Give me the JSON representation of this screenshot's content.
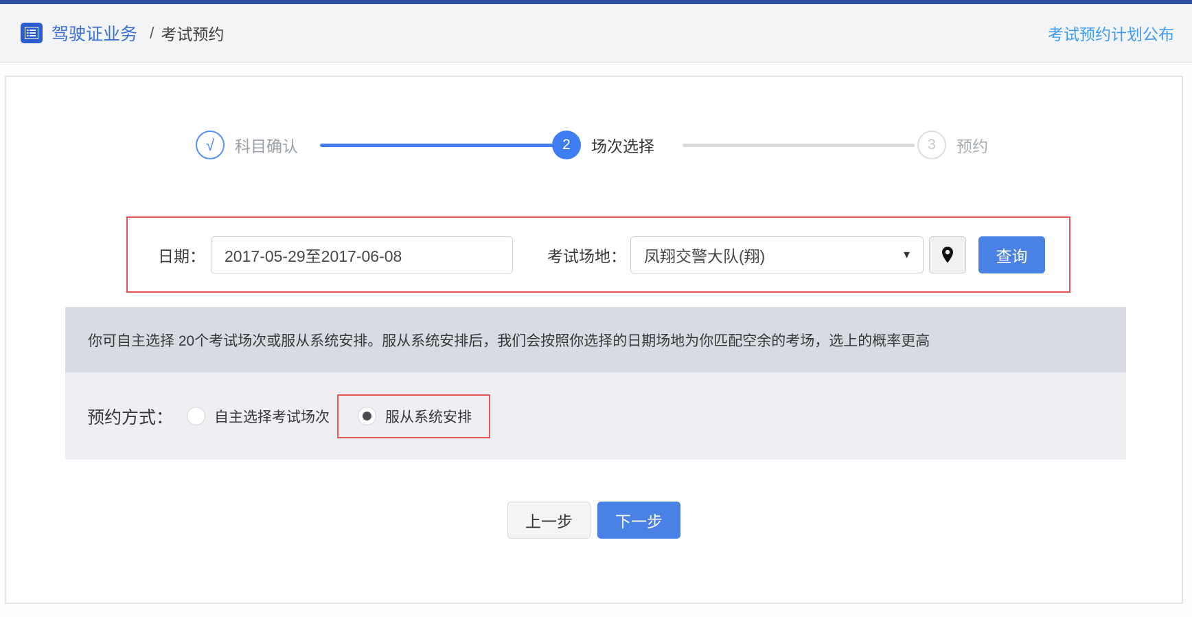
{
  "header": {
    "title": "驾驶证业务",
    "separator": "/",
    "breadcrumb": "考试预约",
    "link": "考试预约计划公布"
  },
  "steps": [
    {
      "number": "√",
      "label": "科目确认",
      "state": "done"
    },
    {
      "number": "2",
      "label": "场次选择",
      "state": "active"
    },
    {
      "number": "3",
      "label": "预约",
      "state": "pending"
    }
  ],
  "filters": {
    "date_label": "日期：",
    "date_value": "2017-05-29至2017-06-08",
    "venue_label": "考试场地：",
    "venue_value": "凤翔交警大队(翔)",
    "venue_caret": "▼",
    "search_button": "查询"
  },
  "notice": "你可自主选择 20个考试场次或服从系统安排。服从系统安排后，我们会按照你选择的日期场地为你匹配空余的考场，选上的概率更高",
  "booking": {
    "label": "预约方式：",
    "options": [
      {
        "label": "自主选择考试场次",
        "selected": false
      },
      {
        "label": "服从系统安排",
        "selected": true
      }
    ]
  },
  "actions": {
    "prev": "上一步",
    "next": "下一步"
  },
  "colors": {
    "topbar": "#2b4fa3",
    "primary_button": "#4a81e4",
    "active_step": "#3f7ef2",
    "link": "#3f9cf3",
    "highlight_border": "#e85555",
    "notice_bg": "#d8dce2",
    "mode_bg": "#edeff2"
  }
}
